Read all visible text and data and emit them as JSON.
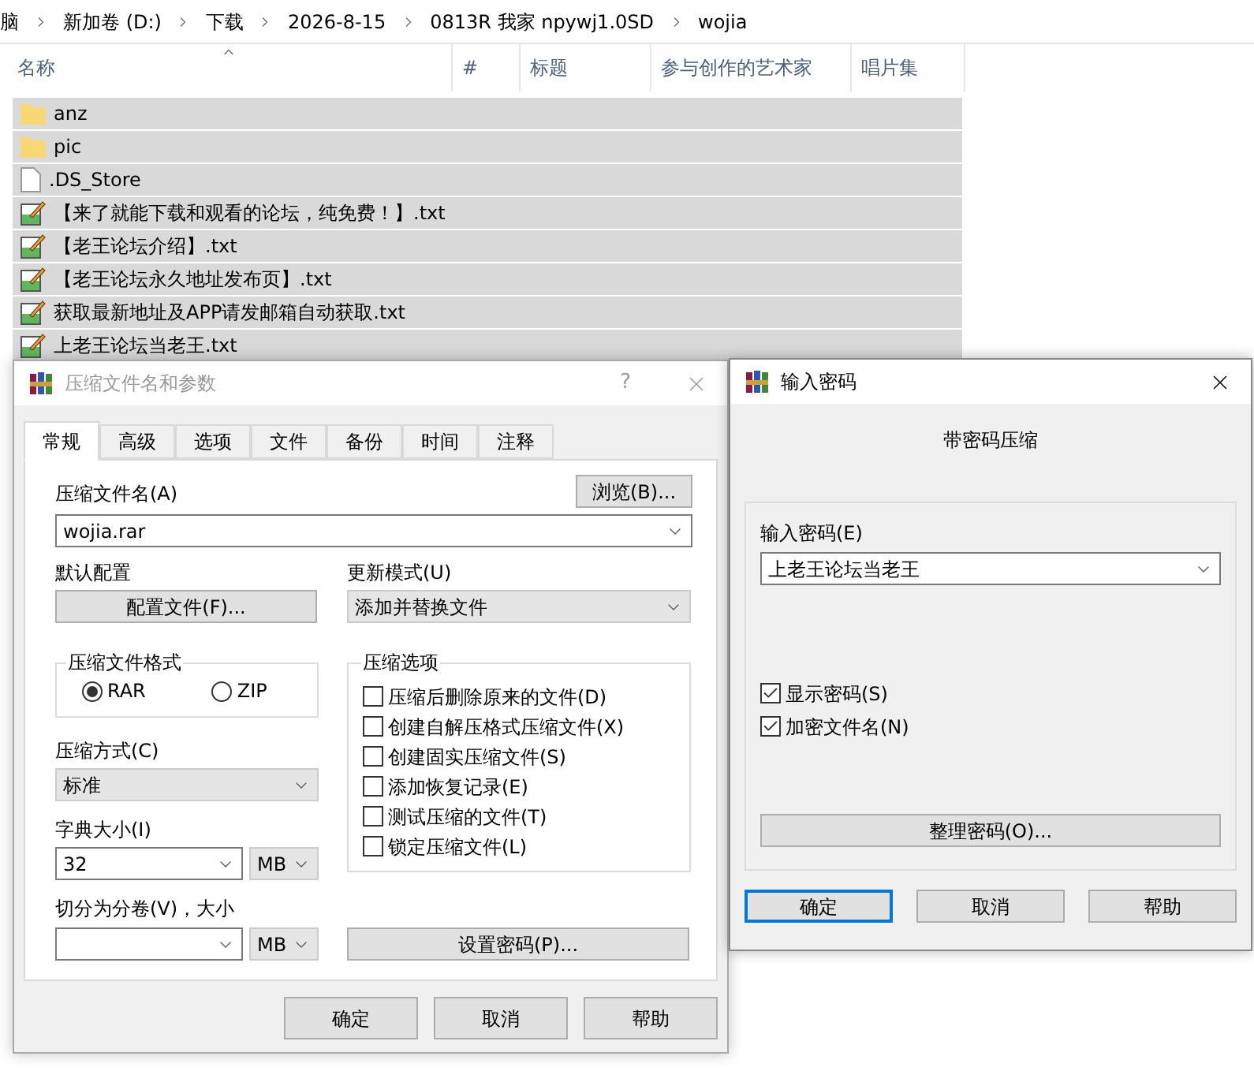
{
  "breadcrumb": [
    "脑",
    "新加卷 (D:)",
    "下载",
    "2026-8-15",
    "0813R 我家 npywj1.0SD",
    "wojia"
  ],
  "file_list": {
    "columns": [
      "名称",
      "#",
      "标题",
      "参与创作的艺术家",
      "唱片集"
    ],
    "files": [
      {
        "name": "anz",
        "kind": "folder",
        "selected": true
      },
      {
        "name": "pic",
        "kind": "folder",
        "selected": true
      },
      {
        "name": ".DS_Store",
        "kind": "file",
        "selected": true
      },
      {
        "name": "【来了就能下载和观看的论坛，纯免费！】.txt",
        "kind": "text",
        "selected": true
      },
      {
        "name": "【老王论坛介绍】.txt",
        "kind": "text",
        "selected": true
      },
      {
        "name": "【老王论坛永久地址发布页】.txt",
        "kind": "text",
        "selected": true
      },
      {
        "name": "获取最新地址及APP请发邮箱自动获取.txt",
        "kind": "text",
        "selected": true
      },
      {
        "name": "上老王论坛当老王.txt",
        "kind": "text",
        "selected": true
      }
    ]
  },
  "archive_dialog": {
    "title": "压缩文件名和参数",
    "active": false,
    "help_symbol": "?",
    "tabs": [
      {
        "label": "常规",
        "selected": true
      },
      {
        "label": "高级",
        "selected": false
      },
      {
        "label": "选项",
        "selected": false
      },
      {
        "label": "文件",
        "selected": false
      },
      {
        "label": "备份",
        "selected": false
      },
      {
        "label": "时间",
        "selected": false
      },
      {
        "label": "注释",
        "selected": false
      }
    ],
    "archive_name_label": "压缩文件名(A)",
    "browse_button": "浏览(B)...",
    "archive_name_value": "wojia.rar",
    "default_profile_label": "默认配置",
    "profiles_button": "配置文件(F)...",
    "update_mode_label": "更新模式(U)",
    "update_mode_value": "添加并替换文件",
    "format_group": {
      "title": "压缩文件格式",
      "options": [
        {
          "label": "RAR",
          "selected": true
        },
        {
          "label": "ZIP",
          "selected": false
        }
      ]
    },
    "options_group": {
      "title": "压缩选项",
      "options": [
        {
          "label": "压缩后删除原来的文件(D)",
          "checked": false
        },
        {
          "label": "创建自解压格式压缩文件(X)",
          "checked": false
        },
        {
          "label": "创建固实压缩文件(S)",
          "checked": false
        },
        {
          "label": "添加恢复记录(E)",
          "checked": false
        },
        {
          "label": "测试压缩的文件(T)",
          "checked": false
        },
        {
          "label": "锁定压缩文件(L)",
          "checked": false
        }
      ]
    },
    "method_label": "压缩方式(C)",
    "method_value": "标准",
    "dictionary_label": "字典大小(I)",
    "dictionary_value": "32",
    "dictionary_unit": "MB",
    "split_label": "切分为分卷(V)，大小",
    "split_unit": "MB",
    "password_button": "设置密码(P)...",
    "buttons": [
      {
        "label": "确定",
        "focused": false
      },
      {
        "label": "取消",
        "focused": false
      },
      {
        "label": "帮助",
        "focused": false
      }
    ]
  },
  "password_dialog": {
    "title": "输入密码",
    "active": true,
    "heading": "带密码压缩",
    "password_label": "输入密码(E)",
    "password_value": "上老王论坛当老王",
    "options": [
      {
        "label": "显示密码(S)",
        "checked": true
      },
      {
        "label": "加密文件名(N)",
        "checked": true
      }
    ],
    "organize_button": "整理密码(O)...",
    "buttons": [
      {
        "label": "确定",
        "focused": true
      },
      {
        "label": "取消",
        "focused": false
      },
      {
        "label": "帮助",
        "focused": false
      }
    ]
  }
}
